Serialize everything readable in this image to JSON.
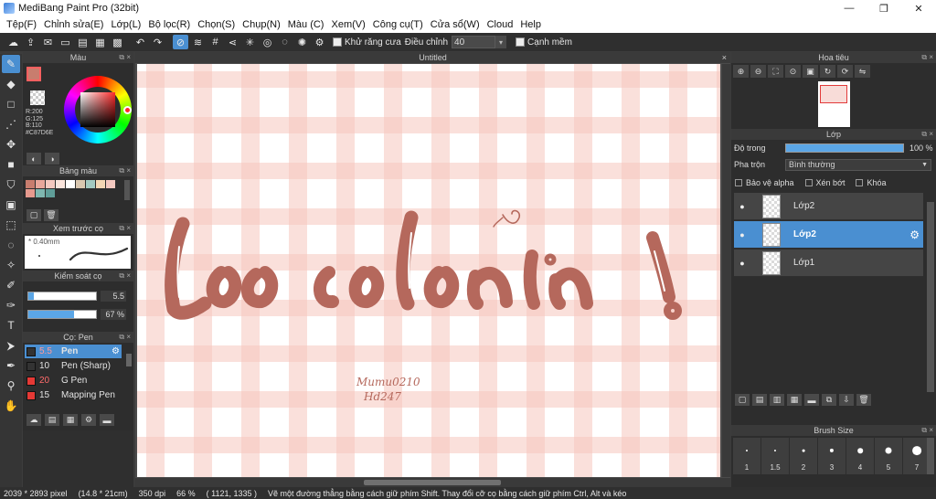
{
  "window": {
    "title": "MediBang Paint Pro (32bit)",
    "min": "—",
    "max": "❐",
    "close": "✕"
  },
  "menu": [
    "Tệp(F)",
    "Chỉnh sửa(E)",
    "Lớp(L)",
    "Bộ lọc(R)",
    "Chọn(S)",
    "Chụp(N)",
    "Màu (C)",
    "Xem(V)",
    "Công cụ(T)",
    "Cửa sổ(W)",
    "Cloud",
    "Help"
  ],
  "toolbar": {
    "antialias_label": "Khử răng cưa",
    "adjust_label": "Điều chỉnh",
    "adjust_value": "40",
    "edge_label": "Cạnh mềm"
  },
  "panels": {
    "color": "Màu",
    "palette": "Bảng màu",
    "preview": "Xem trước cọ",
    "brush_control": "Kiểm soát cọ",
    "brushes": "Cọ: Pen",
    "navigator": "Hoa tiêu",
    "layer": "Lớp",
    "brush_size": "Brush Size"
  },
  "color": {
    "r": "R:200",
    "g": "G:125",
    "b": "B:110",
    "hex": "#C87D6E",
    "main_color": "#C87D6E"
  },
  "palette_colors": [
    "#c87d6e",
    "#e8a79b",
    "#f4c8bf",
    "#fae4dc",
    "#ffffff",
    "#d9c7b0",
    "#a3c9c1",
    "#f3d6b4",
    "#f3c8c0",
    "#e69a8e",
    "#7fb7b0",
    "#5f9d98"
  ],
  "preview": {
    "size": "* 0.40mm"
  },
  "brush_control": {
    "size": "5.5",
    "opacity": "67 %"
  },
  "brushes": [
    {
      "size": "5.5",
      "name": "Pen",
      "color": "#333333"
    },
    {
      "size": "10",
      "name": "Pen (Sharp)",
      "color": "#333333"
    },
    {
      "size": "20",
      "name": "G Pen",
      "color": "#e53935"
    },
    {
      "size": "15",
      "name": "Mapping Pen",
      "color": "#e53935"
    }
  ],
  "canvas": {
    "doc_title": "Untitled",
    "bg_color": "#ffffff",
    "plaid_color": "#f6c7be",
    "lettering_color": "#b5685c",
    "signature_line1": "Mumu0210",
    "signature_line2": "Hd247"
  },
  "layer": {
    "opacity_label": "Độ trong",
    "opacity_value": "100 %",
    "blend_label": "Pha trộn",
    "blend_value": "Bình thường",
    "protect_alpha": "Bảo vệ alpha",
    "clipping": "Xén bớt",
    "lock": "Khóa",
    "layers": [
      {
        "name": "Lớp2",
        "selected": false
      },
      {
        "name": "Lớp2",
        "selected": true
      },
      {
        "name": "Lớp1",
        "selected": false
      }
    ]
  },
  "brush_sizes": [
    "1",
    "1.5",
    "2",
    "3",
    "4",
    "5",
    "7"
  ],
  "status": {
    "dimensions": "2039 * 2893 pixel",
    "physical": "(14.8 * 21cm)",
    "dpi": "350 dpi",
    "zoom": "66 %",
    "cursor": "( 1121, 1335 )",
    "hint": "Vẽ một đường thẳng bằng cách giữ phím Shift. Thay đổi cỡ cọ bằng cách giữ phím Ctrl, Alt và kéo"
  }
}
